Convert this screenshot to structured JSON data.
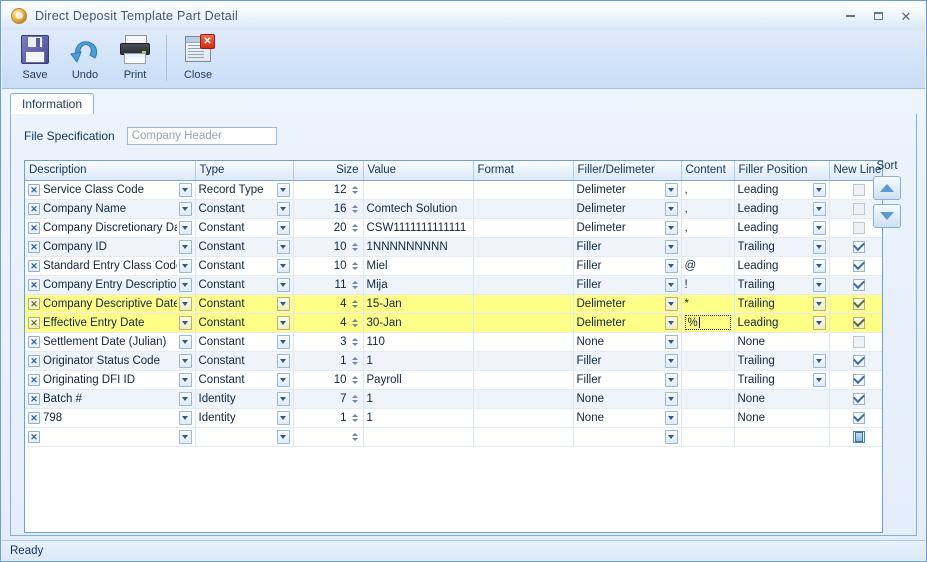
{
  "window": {
    "title": "Direct Deposit Template Part Detail",
    "icon": "app-orb-icon",
    "minimize": "minimize-icon",
    "maximize": "maximize-icon",
    "close": "close-icon"
  },
  "toolbar": {
    "items": [
      {
        "label": "Save",
        "icon": "floppy-disk-icon"
      },
      {
        "label": "Undo",
        "icon": "undo-arrow-icon"
      },
      {
        "label": "Print",
        "icon": "printer-icon"
      },
      {
        "label": "Close",
        "icon": "window-close-icon"
      }
    ]
  },
  "tabs": [
    {
      "label": "Information",
      "active": true
    }
  ],
  "file_specification": {
    "label": "File Specification",
    "value": "",
    "placeholder": "Company Header"
  },
  "grid": {
    "columns": [
      {
        "key": "description",
        "label": "Description",
        "align": "left"
      },
      {
        "key": "type",
        "label": "Type",
        "align": "left"
      },
      {
        "key": "size",
        "label": "Size",
        "align": "right"
      },
      {
        "key": "value",
        "label": "Value",
        "align": "left"
      },
      {
        "key": "format",
        "label": "Format",
        "align": "left"
      },
      {
        "key": "filler_delimeter",
        "label": "Filler/Delimeter",
        "align": "left"
      },
      {
        "key": "content",
        "label": "Content",
        "align": "left"
      },
      {
        "key": "filler_position",
        "label": "Filler Position",
        "align": "left"
      },
      {
        "key": "new_line",
        "label": "New Line",
        "align": "left"
      }
    ],
    "rows": [
      {
        "description": "Service Class Code",
        "type": "Record Type",
        "size": "12",
        "value": "",
        "format": "",
        "filler_delimeter": "Delimeter",
        "content": ",",
        "filler_position": "Leading",
        "new_line": false,
        "new_line_enabled": false,
        "position_has_dropdown": true,
        "highlight": false
      },
      {
        "description": "Company Name",
        "type": "Constant",
        "size": "16",
        "value": "Comtech Solution",
        "format": "",
        "filler_delimeter": "Delimeter",
        "content": ",",
        "filler_position": "Leading",
        "new_line": false,
        "new_line_enabled": false,
        "position_has_dropdown": true,
        "highlight": false
      },
      {
        "description": "Company Discretionary Data",
        "type": "Constant",
        "size": "20",
        "value": "CSW1111111111111",
        "format": "",
        "filler_delimeter": "Delimeter",
        "content": ",",
        "filler_position": "Leading",
        "new_line": false,
        "new_line_enabled": false,
        "position_has_dropdown": true,
        "highlight": false
      },
      {
        "description": "Company ID",
        "type": "Constant",
        "size": "10",
        "value": "1NNNNNNNNN",
        "format": "",
        "filler_delimeter": "Filler",
        "content": "",
        "filler_position": "Trailing",
        "new_line": true,
        "new_line_enabled": true,
        "position_has_dropdown": true,
        "highlight": false
      },
      {
        "description": "Standard Entry Class Code",
        "type": "Constant",
        "size": "10",
        "value": "Miel",
        "format": "",
        "filler_delimeter": "Filler",
        "content": "@",
        "filler_position": "Leading",
        "new_line": true,
        "new_line_enabled": true,
        "position_has_dropdown": true,
        "highlight": false
      },
      {
        "description": "Company Entry Description",
        "type": "Constant",
        "size": "11",
        "value": "Mija",
        "format": "",
        "filler_delimeter": "Filler",
        "content": "!",
        "filler_position": "Trailing",
        "new_line": true,
        "new_line_enabled": true,
        "position_has_dropdown": true,
        "highlight": false
      },
      {
        "description": "Company Descriptive Date",
        "type": "Constant",
        "size": "4",
        "value": "15-Jan",
        "format": "",
        "filler_delimeter": "Delimeter",
        "content": "*",
        "filler_position": "Trailing",
        "new_line": true,
        "new_line_enabled": true,
        "position_has_dropdown": true,
        "highlight": true
      },
      {
        "description": "Effective Entry Date",
        "type": "Constant",
        "size": "4",
        "value": "30-Jan",
        "format": "",
        "filler_delimeter": "Delimeter",
        "content": "%",
        "filler_position": "Leading",
        "new_line": true,
        "new_line_enabled": true,
        "position_has_dropdown": true,
        "highlight": true,
        "content_editing": true
      },
      {
        "description": "Settlement Date (Julian)",
        "type": "Constant",
        "size": "3",
        "value": "110",
        "format": "",
        "filler_delimeter": "None",
        "content": "",
        "filler_position": "None",
        "new_line": false,
        "new_line_enabled": false,
        "position_has_dropdown": false,
        "highlight": false
      },
      {
        "description": "Originator Status Code",
        "type": "Constant",
        "size": "1",
        "value": "1",
        "format": "",
        "filler_delimeter": "Filler",
        "content": "",
        "filler_position": "Trailing",
        "new_line": true,
        "new_line_enabled": true,
        "position_has_dropdown": true,
        "highlight": false
      },
      {
        "description": "Originating DFI ID",
        "type": "Constant",
        "size": "10",
        "value": "Payroll",
        "format": "",
        "filler_delimeter": "Filler",
        "content": "",
        "filler_position": "Trailing",
        "new_line": true,
        "new_line_enabled": true,
        "position_has_dropdown": true,
        "highlight": false
      },
      {
        "description": "Batch #",
        "type": "Identity",
        "size": "7",
        "value": "1",
        "format": "",
        "filler_delimeter": "None",
        "content": "",
        "filler_position": "None",
        "new_line": true,
        "new_line_enabled": true,
        "position_has_dropdown": false,
        "highlight": false
      },
      {
        "description": "798",
        "type": "Identity",
        "size": "1",
        "value": "1",
        "format": "",
        "filler_delimeter": "None",
        "content": "",
        "filler_position": "None",
        "new_line": true,
        "new_line_enabled": true,
        "position_has_dropdown": false,
        "highlight": false
      },
      {
        "description": "",
        "type": "",
        "size": "",
        "value": "",
        "format": "",
        "filler_delimeter": "",
        "content": "",
        "filler_position": "",
        "new_line": false,
        "new_line_enabled": true,
        "position_has_dropdown": false,
        "highlight": false,
        "is_new_row": true,
        "new_line_focused": true
      }
    ]
  },
  "sort": {
    "label": "Sort",
    "up_icon": "triangle-up-icon",
    "down_icon": "triangle-down-icon"
  },
  "status": {
    "text": "Ready"
  },
  "colors": {
    "highlight_row": "#ffff88",
    "accent": "#5b9bd5",
    "border": "#6f9fd0",
    "text": "#12355a"
  }
}
